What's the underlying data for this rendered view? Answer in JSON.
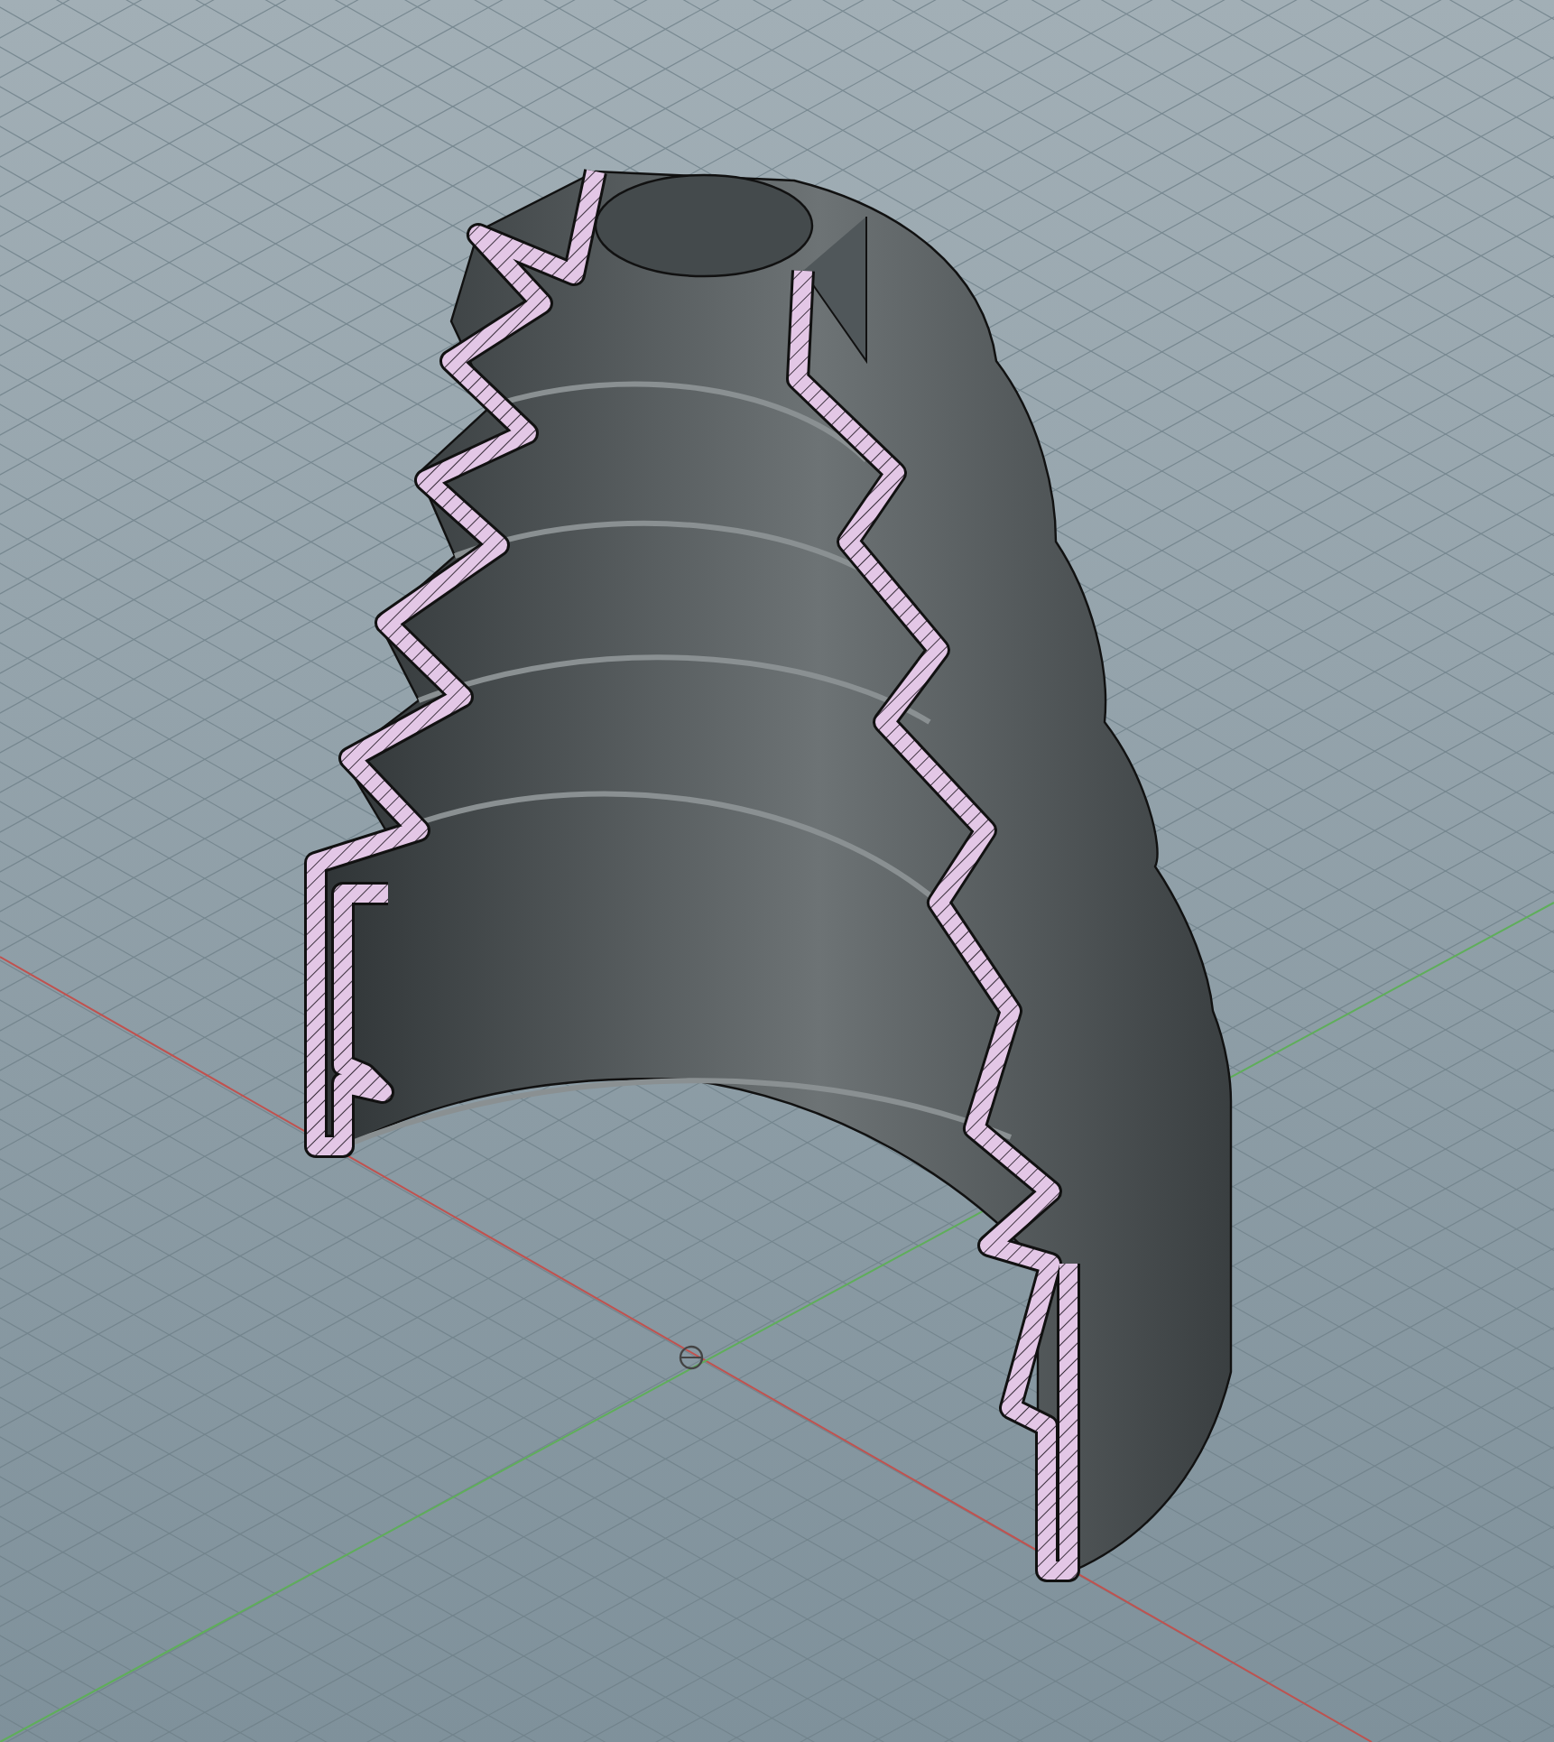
{
  "viewport": {
    "grid_visible": true,
    "axes_visible": true
  }
}
